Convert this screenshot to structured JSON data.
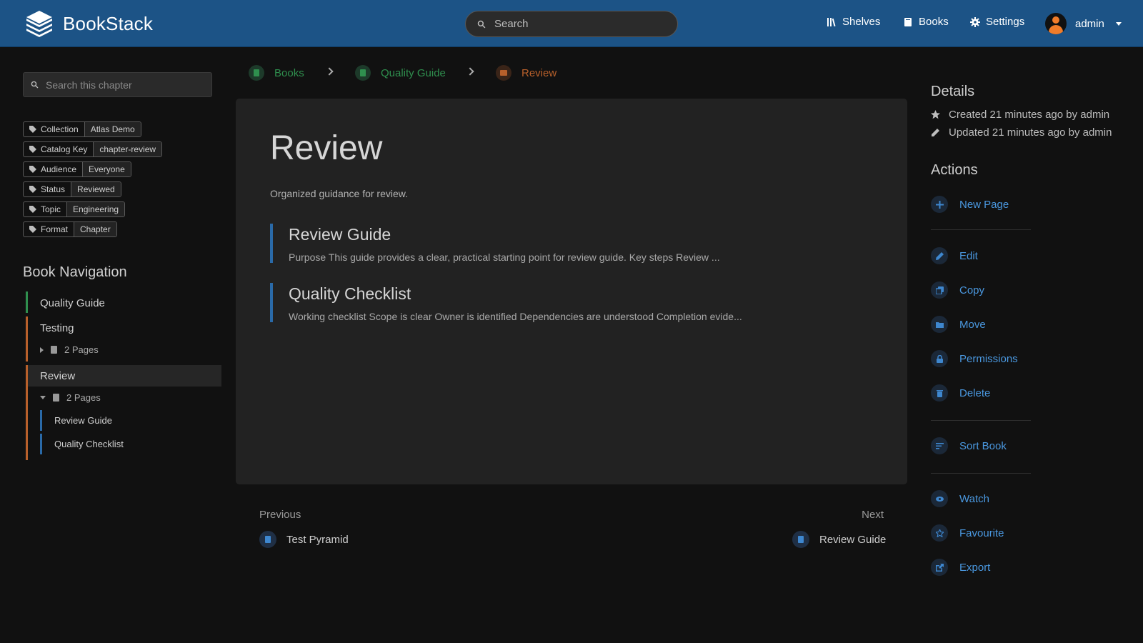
{
  "header": {
    "app_name": "BookStack",
    "search_placeholder": "Search",
    "nav": {
      "shelves": "Shelves",
      "books": "Books",
      "settings": "Settings"
    },
    "user": "admin"
  },
  "left": {
    "chapter_search_placeholder": "Search this chapter",
    "tags": [
      {
        "key": "Collection",
        "value": "Atlas Demo"
      },
      {
        "key": "Catalog Key",
        "value": "chapter-review"
      },
      {
        "key": "Audience",
        "value": "Everyone"
      },
      {
        "key": "Status",
        "value": "Reviewed"
      },
      {
        "key": "Topic",
        "value": "Engineering"
      },
      {
        "key": "Format",
        "value": "Chapter"
      }
    ],
    "book_nav_title": "Book Navigation",
    "book_nav": {
      "quality_guide": "Quality Guide",
      "testing": "Testing",
      "testing_pages": "2 Pages",
      "review": "Review",
      "review_pages": "2 Pages",
      "review_sub": [
        "Review Guide",
        "Quality Checklist"
      ]
    }
  },
  "breadcrumb": {
    "books": "Books",
    "book": "Quality Guide",
    "chapter": "Review",
    "colors": {
      "book": "#2f8f4e",
      "chapter": "#b8602b"
    }
  },
  "main": {
    "title": "Review",
    "description": "Organized guidance for review.",
    "entries": [
      {
        "title": "Review Guide",
        "excerpt": "Purpose This guide provides a clear, practical starting point for review guide. Key steps Review ..."
      },
      {
        "title": "Quality Checklist",
        "excerpt": "Working checklist Scope is clear Owner is identified Dependencies are understood Completion evide..."
      }
    ],
    "previous_label": "Previous",
    "previous_link": "Test Pyramid",
    "next_label": "Next",
    "next_link": "Review Guide"
  },
  "right": {
    "details_title": "Details",
    "created": "Created 21 minutes ago by admin",
    "updated": "Updated 21 minutes ago by admin",
    "actions_title": "Actions",
    "actions": {
      "new_page": "New Page",
      "edit": "Edit",
      "copy": "Copy",
      "move": "Move",
      "permissions": "Permissions",
      "delete": "Delete",
      "sort_book": "Sort Book",
      "watch": "Watch",
      "favourite": "Favourite",
      "export": "Export"
    }
  },
  "colors": {
    "header": "#1c5386",
    "link": "#4a98e0",
    "background": "#111111",
    "card": "#222222"
  }
}
